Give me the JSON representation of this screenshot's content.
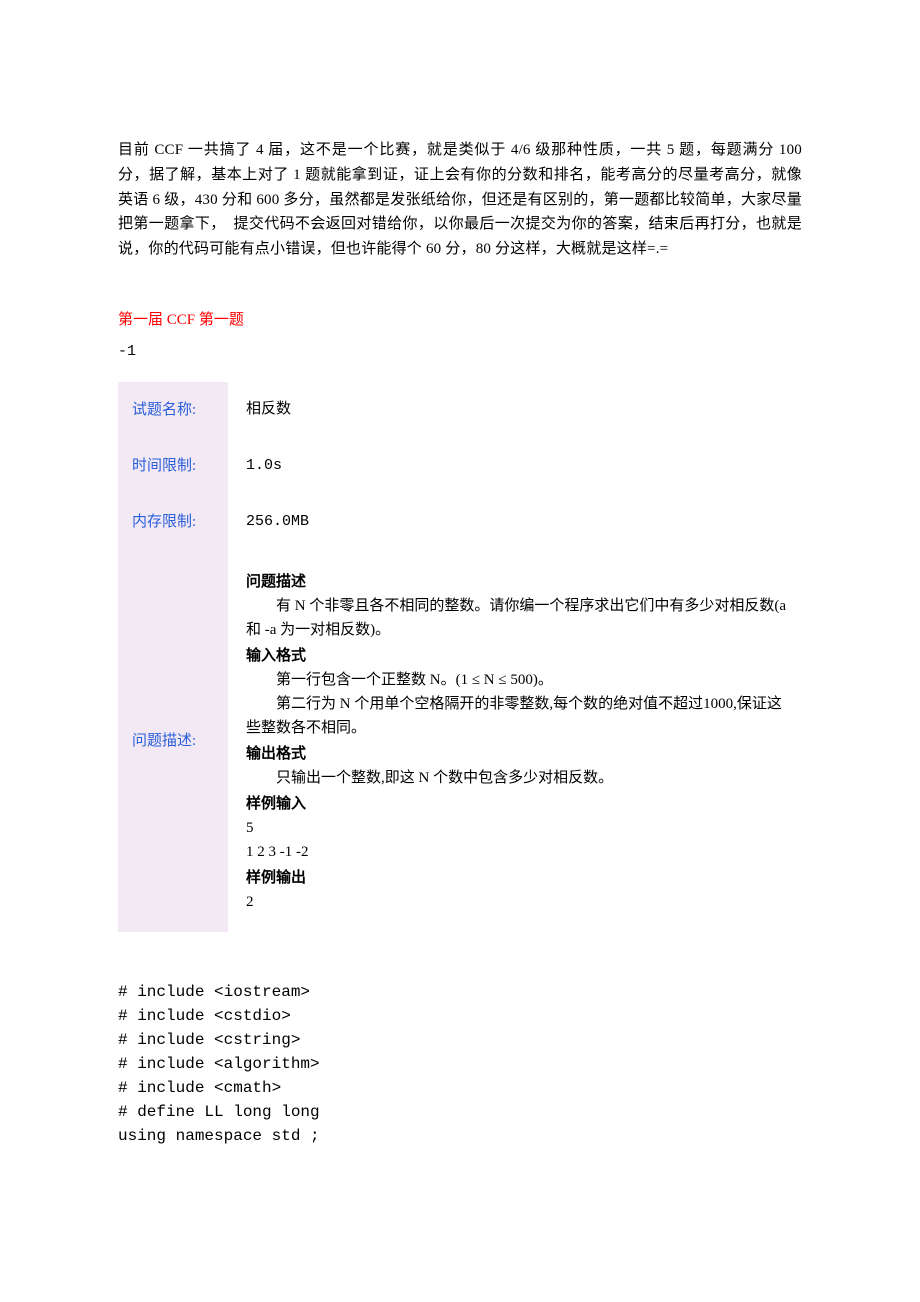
{
  "intro": "目前 CCF 一共搞了 4 届，这不是一个比赛，就是类似于 4/6 级那种性质，一共 5 题，每题满分 100 分，据了解，基本上对了 1 题就能拿到证，证上会有你的分数和排名，能考高分的尽量考高分，就像英语 6 级，430 分和 600 多分，虽然都是发张纸给你，但还是有区别的，第一题都比较简单，大家尽量把第一题拿下，　提交代码不会返回对错给你，以你最后一次提交为你的答案，结束后再打分，也就是说，你的代码可能有点小错误，但也许能得个 60 分，80 分这样，大概就是这样=.=",
  "section_title": "第一届 CCF 第一题",
  "minus_line": "-1",
  "rows": {
    "name_label": "试题名称:",
    "name_value": "相反数",
    "time_label": "时间限制:",
    "time_value": "1.0s",
    "mem_label": "内存限制:",
    "mem_value": "256.0MB",
    "desc_label": "问题描述:"
  },
  "desc": {
    "h1": "问题描述",
    "p1": "有 N 个非零且各不相同的整数。请你编一个程序求出它们中有多少对相反数(a 和 -a 为一对相反数)。",
    "h2": "输入格式",
    "p2a": "第一行包含一个正整数 N。(1 ≤ N ≤ 500)。",
    "p2b": "第二行为 N 个用单个空格隔开的非零整数,每个数的绝对值不超过1000,保证这些整数各不相同。",
    "h3": "输出格式",
    "p3": "只输出一个整数,即这 N 个数中包含多少对相反数。",
    "h4": "样例输入",
    "s_in1": "5",
    "s_in2": "1 2 3 -1 -2",
    "h5": "样例输出",
    "s_out": "2"
  },
  "code": "# include <iostream>\n# include <cstdio>\n# include <cstring>\n# include <algorithm>\n# include <cmath>\n# define LL long long\nusing namespace std ;"
}
